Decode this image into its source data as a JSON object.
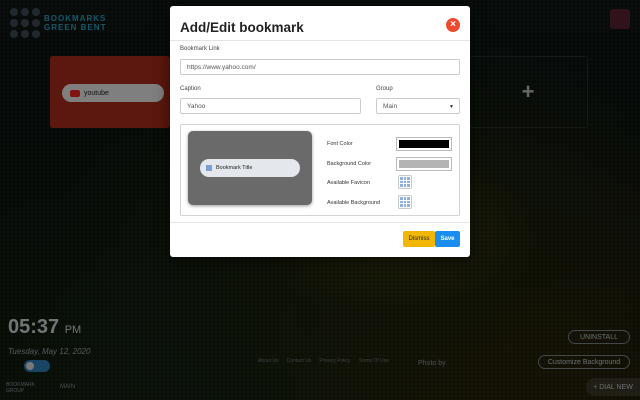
{
  "background": {
    "logo_text": "BOOKMARKS GREEN BENT",
    "tiles": {
      "youtube_label": "youtube",
      "add_label": "+"
    },
    "clock": {
      "time": "05:37",
      "ampm": "PM"
    },
    "date": "Tuesday, May 12, 2020",
    "bottom_left_tab": "BOOKMARK GROUP",
    "bottom_left_main": "MAIN",
    "footer_links": [
      "About Us",
      "Contact Us",
      "Privacy Policy",
      "Terms Of Use"
    ],
    "photo_by": "Photo by",
    "uninstall_label": "UNINSTALL",
    "customize_label": "Customize Background",
    "extra_label": "+ DIAL NEW"
  },
  "modal": {
    "title": "Add/Edit bookmark",
    "close_label": "×",
    "bookmark_link": {
      "label": "Bookmark Link",
      "value": "https://www.yahoo.com/"
    },
    "caption": {
      "label": "Caption",
      "value": "Yahoo"
    },
    "group": {
      "label": "Group",
      "value": "Main",
      "caret": "▼"
    },
    "preview": {
      "title": "Bookmark Title"
    },
    "options": {
      "font_color_label": "Font Color",
      "font_color": "#000000",
      "background_color_label": "Background Color",
      "background_color": "#b4b4b4",
      "available_favicon_label": "Available Favicon",
      "available_background_label": "Available Background"
    },
    "buttons": {
      "dismiss": "Dismiss",
      "save": "Save"
    }
  },
  "colors": {
    "accent_blue": "#1a8ef0",
    "dismiss_yellow": "#f2b705",
    "close_red": "#ee4a2e"
  }
}
